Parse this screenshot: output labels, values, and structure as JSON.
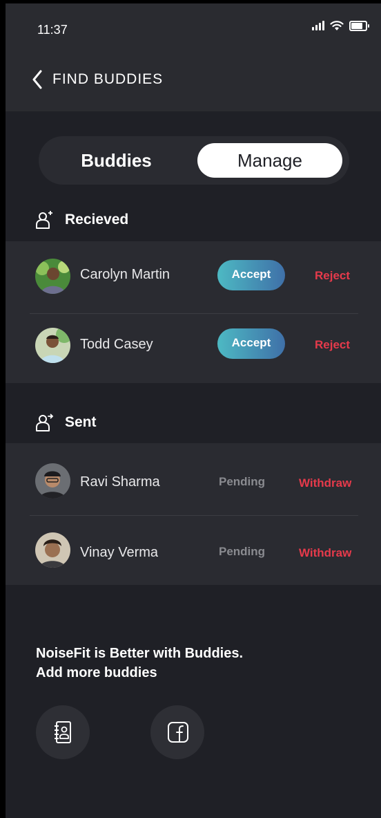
{
  "status_bar": {
    "time": "11:37"
  },
  "header": {
    "title": "FIND BUDDIES"
  },
  "tabs": [
    {
      "label": "Buddies",
      "selected": false
    },
    {
      "label": "Manage",
      "selected": true
    }
  ],
  "received": {
    "title": "Recieved",
    "items": [
      {
        "name": "Carolyn Martin",
        "accept_label": "Accept",
        "reject_label": "Reject"
      },
      {
        "name": "Todd Casey",
        "accept_label": "Accept",
        "reject_label": "Reject"
      }
    ]
  },
  "sent": {
    "title": "Sent",
    "items": [
      {
        "name": "Ravi Sharma",
        "status": "Pending",
        "withdraw_label": "Withdraw"
      },
      {
        "name": "Vinay Verma",
        "status": "Pending",
        "withdraw_label": "Withdraw"
      }
    ]
  },
  "promo": {
    "line1": "NoiseFit is Better with Buddies.",
    "line2": "Add more buddies"
  },
  "add_options": [
    {
      "icon": "contacts-book-icon"
    },
    {
      "icon": "facebook-icon"
    }
  ],
  "colors": {
    "background": "#1f2026",
    "panel": "#2a2b31",
    "accent_gradient_start": "#4db9c3",
    "accent_gradient_end": "#3f70a8",
    "danger": "#e63a4b",
    "muted": "#8a8b90"
  }
}
